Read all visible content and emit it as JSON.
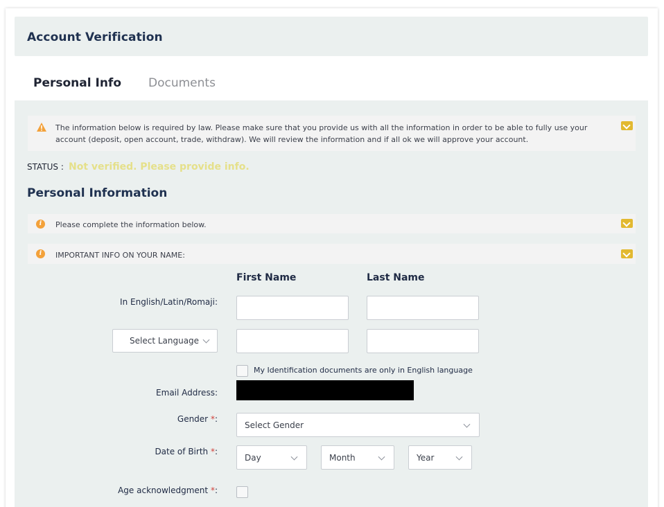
{
  "header": {
    "title": "Account Verification"
  },
  "tabs": [
    {
      "label": "Personal Info",
      "active": true
    },
    {
      "label": "Documents",
      "active": false
    }
  ],
  "notice_law": {
    "text": "The information below is required by law. Please make sure that you provide us with all the information in order to be able to fully use your account (deposit, open account, trade, withdraw). We will review the information and if all ok we will approve your account."
  },
  "status": {
    "label": "STATUS :",
    "value": "Not verified. Please provide info."
  },
  "section": {
    "title": "Personal Information"
  },
  "notice_complete": {
    "text": "Please complete the information below."
  },
  "notice_name": {
    "text": "IMPORTANT INFO ON YOUR NAME:"
  },
  "form": {
    "first_name_header": "First Name",
    "last_name_header": "Last Name",
    "english_label": "In English/Latin/Romaji:",
    "language_select": "Select Language",
    "english_only_checkbox_label": "My Identification documents are only in English language",
    "email_label": "Email Address:",
    "gender_label": "Gender",
    "gender_select": "Select Gender",
    "dob_label": "Date of Birth",
    "dob_day": "Day",
    "dob_month": "Month",
    "dob_year": "Year",
    "age_label": "Age acknowledgment",
    "required_mark": "*",
    "colon": ":"
  },
  "colors": {
    "accent": "#e2b930",
    "status": "#e5e08a",
    "warning": "#f3a13a",
    "heading": "#1f3150"
  }
}
